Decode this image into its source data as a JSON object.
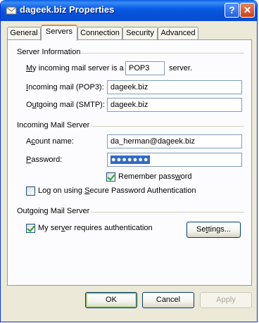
{
  "window": {
    "title": "dageek.biz Properties",
    "help_glyph": "?",
    "close_glyph": "✕"
  },
  "tabs": [
    {
      "label": "General"
    },
    {
      "label": "Servers",
      "active": true
    },
    {
      "label": "Connection"
    },
    {
      "label": "Security"
    },
    {
      "label": "Advanced"
    }
  ],
  "server_info": {
    "heading": "Server Information",
    "incoming_type_prefix": "y incoming mail server is a",
    "incoming_type_mnemonic": "M",
    "incoming_type_value": "POP3",
    "incoming_type_suffix": "server.",
    "incoming_mail_mnemonic": "I",
    "incoming_mail_label": "ncoming mail (POP3):",
    "incoming_mail_value": "dageek.biz",
    "outgoing_mail_mnemonic": "u",
    "outgoing_mail_label_pre": "O",
    "outgoing_mail_label_post": "tgoing mail (SMTP):",
    "outgoing_mail_value": "dageek.biz"
  },
  "incoming_server": {
    "heading": "Incoming Mail Server",
    "account_label_pre": "Ac",
    "account_mnemonic": "c",
    "account_label_post": "ount name:",
    "account_value": "da_herman@dageek.biz",
    "password_label_pre": "",
    "password_mnemonic": "P",
    "password_label_post": "assword:",
    "password_mask": "●●●●●●●",
    "remember_label_pre": "Remember pass",
    "remember_mnemonic": "w",
    "remember_label_post": "ord",
    "remember_checked": true,
    "spa_label_pre": "Log on using ",
    "spa_mnemonic": "S",
    "spa_label_post": "ecure Password Authentication",
    "spa_checked": false
  },
  "outgoing_server": {
    "heading": "Outgoing Mail Server",
    "auth_label_pre": "My ser",
    "auth_mnemonic": "v",
    "auth_label_post": "er requires authentication",
    "auth_checked": true,
    "settings_mnemonic": "t",
    "settings_label_pre": "Se",
    "settings_label_post": "tings..."
  },
  "buttons": {
    "ok": "OK",
    "cancel": "Cancel",
    "apply": "Apply"
  },
  "colors": {
    "titlebar": "#0550d6",
    "dialog_bg": "#ece9d8",
    "tab_active_accent": "#e68b2c",
    "check_mark": "#21a121",
    "selection": "#316ac5"
  }
}
